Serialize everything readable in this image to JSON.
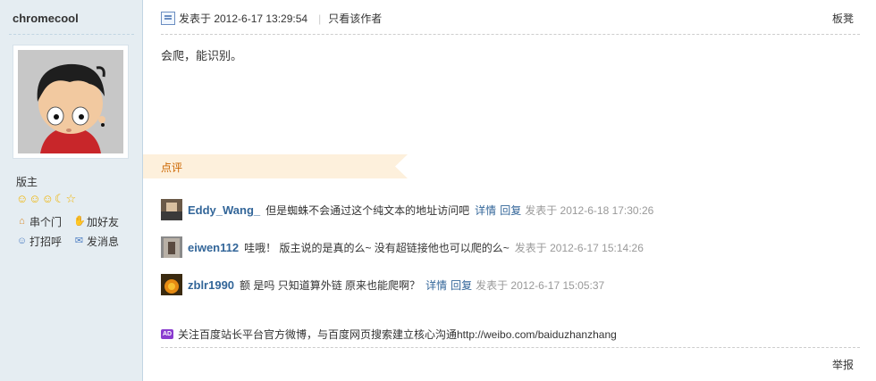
{
  "author": {
    "name": "chromecool",
    "role": "版主",
    "actions": [
      {
        "label": "串个门",
        "icon": "home-icon"
      },
      {
        "label": "加好友",
        "icon": "handshake-icon"
      },
      {
        "label": "打招呼",
        "icon": "greet-icon"
      },
      {
        "label": "发消息",
        "icon": "mail-icon"
      }
    ]
  },
  "post": {
    "posted_at": "发表于 2012-6-17 13:29:54",
    "only_author": "只看该作者",
    "floor": "板凳",
    "content": "会爬，能识别。"
  },
  "comments_label": "点评",
  "comments": [
    {
      "user": "Eddy_Wang_",
      "text": "但是蜘蛛不会通过这个纯文本的地址访问吧",
      "detail": "详情",
      "reply": "回复",
      "time": "发表于 2012-6-18 17:30:26"
    },
    {
      "user": "eiwen112",
      "text": "哇哦！ 版主说的是真的么~ 没有超链接他也可以爬的么~",
      "detail": "",
      "reply": "",
      "time": "发表于 2012-6-17 15:14:26"
    },
    {
      "user": "zblr1990",
      "text": "额 是吗 只知道算外链 原来也能爬啊？",
      "detail": "详情",
      "reply": "回复",
      "time": "发表于 2012-6-17 15:05:37"
    }
  ],
  "ad": {
    "badge": "AD",
    "text": "关注百度站长平台官方微博，与百度网页搜索建立核心沟通http://weibo.com/baiduzhanzhang"
  },
  "report": "举报",
  "colors": {
    "sidebar_bg": "#e5edf2",
    "link": "#336699",
    "dianping": "#c60",
    "time": "#999999"
  }
}
